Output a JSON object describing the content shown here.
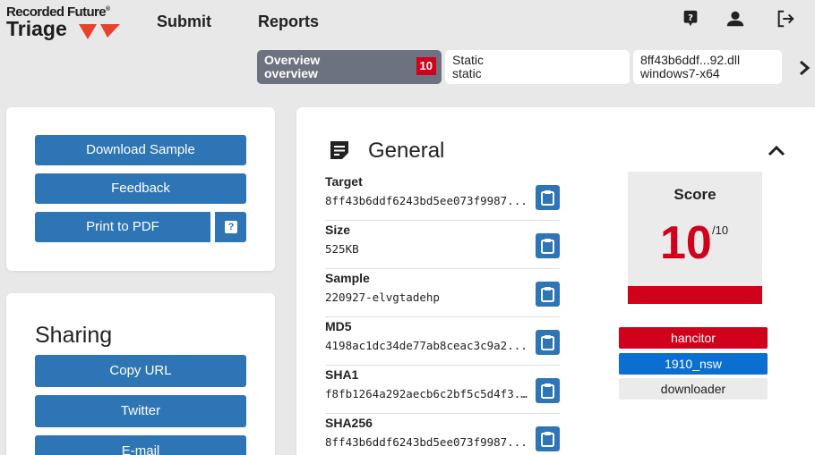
{
  "header": {
    "brand": "Recorded Future",
    "brand_mark": "®",
    "product": "Triage",
    "nav": [
      "Submit",
      "Reports"
    ],
    "icons": [
      "help-icon",
      "user-icon",
      "logout-icon"
    ]
  },
  "tabs": [
    {
      "title": "Overview",
      "subtitle": "overview",
      "badge": "10",
      "active": true
    },
    {
      "title": "Static",
      "subtitle": "static",
      "active": false
    },
    {
      "title": "8ff43b6ddf...92.dll",
      "subtitle": "windows7-x64",
      "active": false
    }
  ],
  "actions": {
    "download": "Download Sample",
    "feedback": "Feedback",
    "print": "Print to PDF",
    "print_help": "?"
  },
  "sharing": {
    "title": "Sharing",
    "copy_url": "Copy URL",
    "twitter": "Twitter",
    "email": "E-mail"
  },
  "general": {
    "title": "General",
    "properties": [
      {
        "label": "Target",
        "value": "8ff43b6ddf6243bd5ee073f9987..."
      },
      {
        "label": "Size",
        "value": "525KB"
      },
      {
        "label": "Sample",
        "value": "220927-elvgtadehp"
      },
      {
        "label": "MD5",
        "value": "4198ac1dc34de77ab8ceac3c9a2..."
      },
      {
        "label": "SHA1",
        "value": "f8fb1264a292aecb6c2bf5c5d4f3..."
      },
      {
        "label": "SHA256",
        "value": "8ff43b6ddf6243bd5ee073f9987..."
      }
    ],
    "score": {
      "title": "Score",
      "value": "10",
      "max": "/10"
    },
    "tags": [
      {
        "text": "hancitor",
        "color": "#d0021b",
        "text_color": "#ffffff"
      },
      {
        "text": "1910_nsw",
        "color": "#0a6fd0",
        "text_color": "#ffffff"
      },
      {
        "text": "downloader",
        "color": "#ebebeb",
        "text_color": "#222222"
      }
    ]
  },
  "colors": {
    "accent": "#2e75b6",
    "danger": "#d0021b",
    "tab_active": "#6d7281"
  }
}
